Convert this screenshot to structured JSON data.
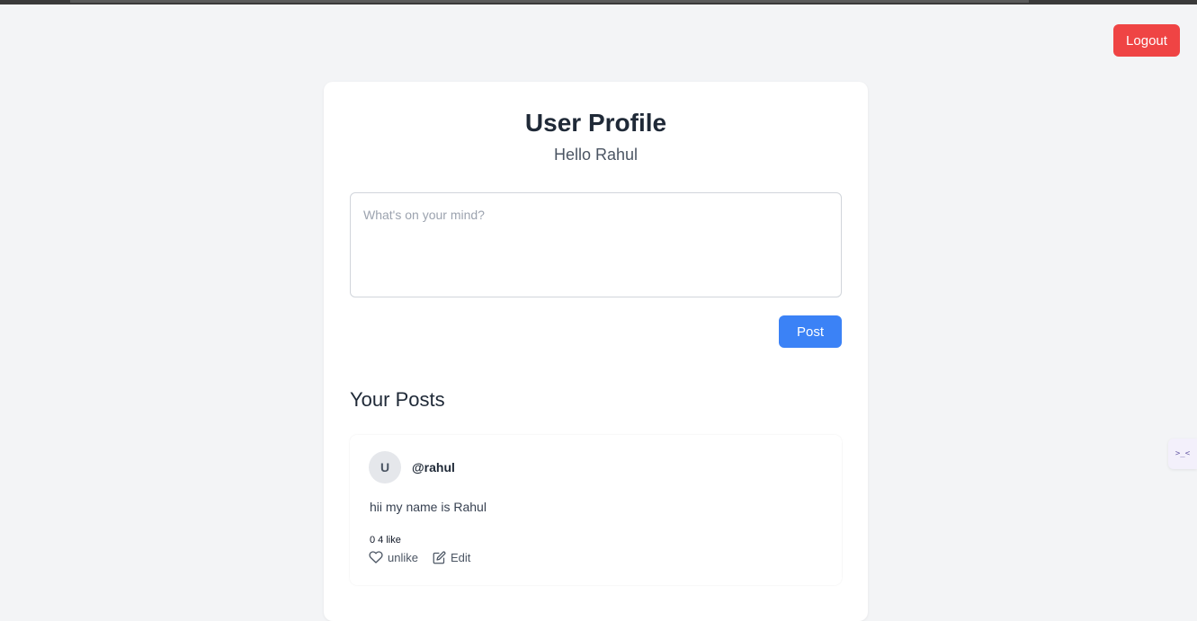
{
  "header": {
    "logout_label": "Logout"
  },
  "profile": {
    "title": "User Profile",
    "greeting": "Hello Rahul"
  },
  "composer": {
    "placeholder": "What's on your mind?",
    "value": "",
    "post_label": "Post"
  },
  "posts_section": {
    "title": "Your Posts",
    "posts": [
      {
        "avatar_initial": "U",
        "username": "@rahul",
        "content": "hii my name is Rahul",
        "like_count_text": "0 4 like",
        "like_action_label": "unlike",
        "edit_action_label": "Edit"
      }
    ]
  },
  "side_widget": {
    "glyph": ">_<"
  },
  "colors": {
    "page_background": "#f3f4f6",
    "logout": "#ef4444",
    "post_button": "#3b82f6"
  },
  "icons": {
    "like": "heart-icon",
    "edit": "edit-icon"
  }
}
